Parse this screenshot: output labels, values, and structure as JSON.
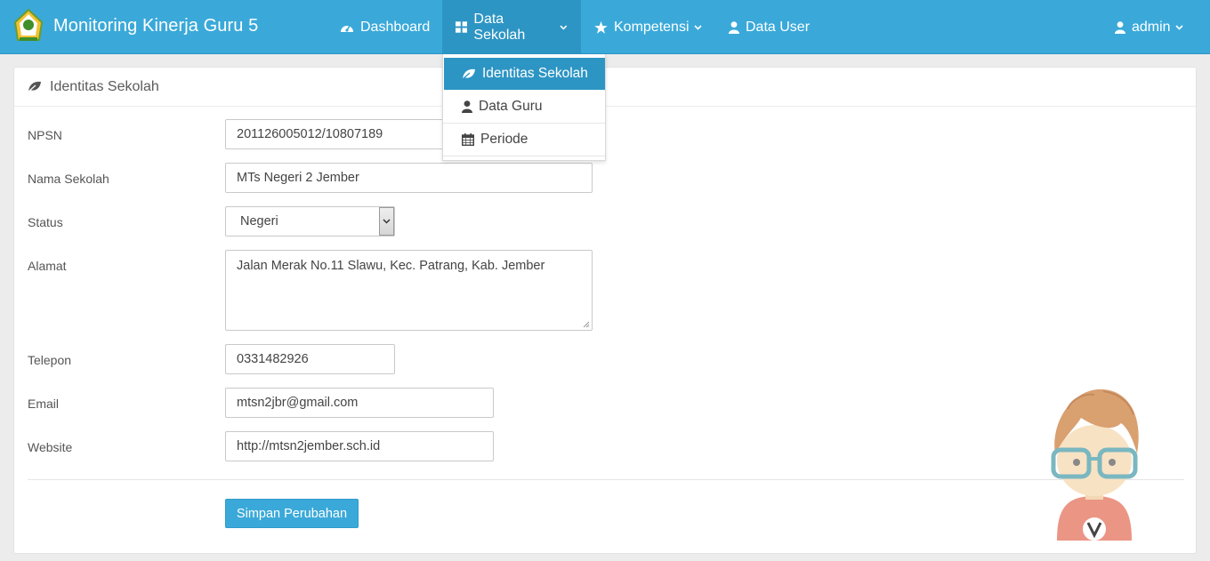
{
  "app": {
    "title": "Monitoring Kinerja Guru 5",
    "brand_color": "#3aa9d9"
  },
  "nav": {
    "items": [
      {
        "label": "Dashboard",
        "icon": "dashboard-icon"
      },
      {
        "label": "Data Sekolah",
        "icon": "grid-icon",
        "dropdown": true,
        "active": true
      },
      {
        "label": "Kompetensi",
        "icon": "star-icon",
        "dropdown": true
      },
      {
        "label": "Data User",
        "icon": "user-icon"
      }
    ],
    "user": {
      "label": "admin",
      "icon": "user-icon"
    }
  },
  "dropdown": {
    "items": [
      {
        "label": "Identitas Sekolah",
        "icon": "leaf-icon",
        "active": true
      },
      {
        "label": "Data Guru",
        "icon": "user-icon"
      },
      {
        "label": "Periode",
        "icon": "calendar-icon"
      }
    ]
  },
  "panel": {
    "title": "Identitas Sekolah",
    "icon": "leaf-icon"
  },
  "form": {
    "npsn": {
      "label": "NPSN",
      "value": "201126005012/10807189"
    },
    "nama": {
      "label": "Nama Sekolah",
      "value": "MTs Negeri 2 Jember"
    },
    "status": {
      "label": "Status",
      "value": "Negeri"
    },
    "alamat": {
      "label": "Alamat",
      "value": "Jalan Merak No.11 Slawu, Kec. Patrang, Kab. Jember"
    },
    "telepon": {
      "label": "Telepon",
      "value": "0331482926"
    },
    "email": {
      "label": "Email",
      "value": "mtsn2jbr@gmail.com"
    },
    "website": {
      "label": "Website",
      "value": "http://mtsn2jember.sch.id"
    },
    "submit_label": "Simpan Perubahan"
  }
}
